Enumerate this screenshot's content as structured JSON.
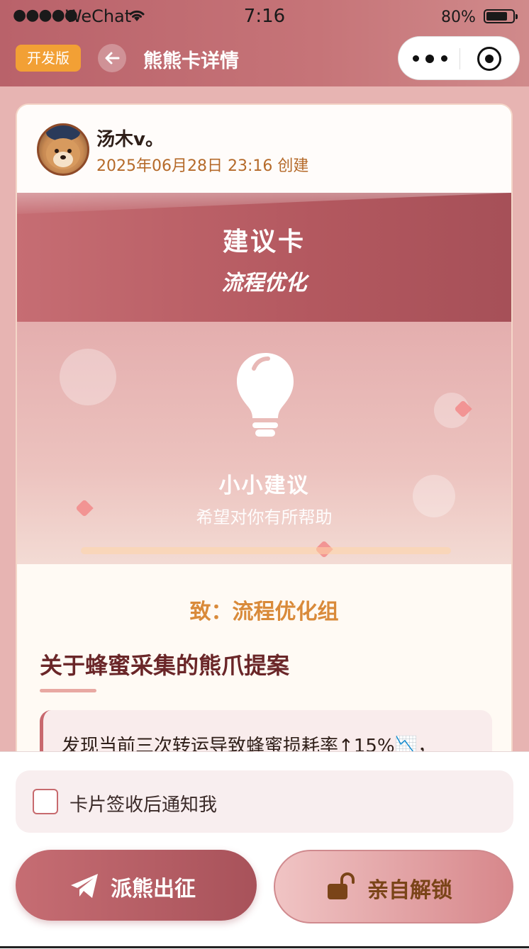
{
  "status": {
    "signal": "●●●●●",
    "carrier": "WeChat",
    "time": "7:16",
    "battery_percent": "80%",
    "battery_level": 0.8
  },
  "nav": {
    "dev_badge": "开发版",
    "title": "熊熊卡详情",
    "icons": [
      "back-arrow-icon",
      "more-dots-icon",
      "target-close-icon"
    ]
  },
  "card": {
    "author": {
      "name": "汤木v。",
      "created": "2025年06月28日 23:16 创建"
    },
    "banner": {
      "title": "建议卡",
      "subtitle": "流程优化"
    },
    "hero": {
      "icon": "lightbulb-icon",
      "title": "小小建议",
      "subtitle": "希望对你有所帮助"
    },
    "recipient": "致：流程优化组",
    "subject": "关于蜂蜜采集的熊爪提案",
    "content": "发现当前三次转运导致蜂蜜损耗率↑15%📉，"
  },
  "bottom": {
    "notify_label": "卡片签收后通知我",
    "notify_checked": false,
    "send_label": "派熊出征",
    "unlock_label": "亲自解锁"
  },
  "colors": {
    "primary": "#b3585f",
    "accent": "#d98a3a",
    "dev_badge": "#f2a035"
  }
}
